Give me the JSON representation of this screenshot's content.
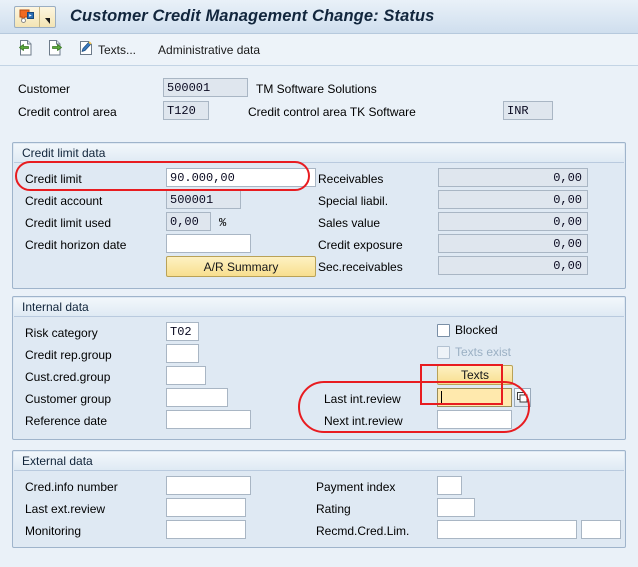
{
  "window": {
    "title": "Customer Credit Management Change: Status",
    "system_menu_icon": "sap-system-menu-icon"
  },
  "toolbar": {
    "back_icon": "back-page-icon",
    "forward_icon": "forward-page-icon",
    "texts_icon": "texts-pencil-icon",
    "texts_label": "Texts...",
    "admin_data_label": "Administrative data"
  },
  "header": {
    "customer_label": "Customer",
    "customer_value": "500001",
    "customer_name": "TM Software Solutions",
    "control_area_label": "Credit control area",
    "control_area_value": "T120",
    "control_area_desc": "Credit control area TK Software",
    "currency_value": "INR"
  },
  "credit_limit_data": {
    "title": "Credit limit data",
    "left_rows": [
      {
        "label": "Credit limit",
        "value": "90.000,00",
        "state": "editable"
      },
      {
        "label": "Credit account",
        "value": "500001",
        "state": "display"
      },
      {
        "label": "Credit limit used",
        "value": "0,00",
        "state": "display",
        "suffix": "%"
      },
      {
        "label": "Credit horizon date",
        "value": "",
        "state": "editable"
      }
    ],
    "ar_summary_button": "A/R Summary",
    "right_rows": [
      {
        "label": "Receivables",
        "value": "0,00"
      },
      {
        "label": "Special liabil.",
        "value": "0,00"
      },
      {
        "label": "Sales value",
        "value": "0,00"
      },
      {
        "label": "Credit exposure",
        "value": "0,00"
      },
      {
        "label": "Sec.receivables",
        "value": "0,00"
      }
    ]
  },
  "internal_data": {
    "title": "Internal data",
    "left_rows": [
      {
        "label": "Risk category",
        "value": "T02"
      },
      {
        "label": "Credit rep.group",
        "value": ""
      },
      {
        "label": "Cust.cred.group",
        "value": ""
      },
      {
        "label": "Customer group",
        "value": ""
      },
      {
        "label": "Reference date",
        "value": ""
      }
    ],
    "blocked_label": "Blocked",
    "blocked_checked": false,
    "texts_exist_label": "Texts exist",
    "texts_exist_checked": false,
    "texts_exist_disabled": true,
    "texts_button": "Texts",
    "last_int_review_label": "Last int.review",
    "last_int_review_value": "",
    "next_int_review_label": "Next int.review",
    "next_int_review_value": "",
    "matchcode_icon": "matchcode-value-help-icon"
  },
  "external_data": {
    "title": "External data",
    "left_rows": [
      {
        "label": "Cred.info number",
        "value": ""
      },
      {
        "label": "Last ext.review",
        "value": ""
      },
      {
        "label": "Monitoring",
        "value": ""
      }
    ],
    "right_rows": [
      {
        "label": "Payment index",
        "value": ""
      },
      {
        "label": "Rating",
        "value": ""
      },
      {
        "label": "Recmd.Cred.Lim.",
        "value": "",
        "value2": ""
      }
    ]
  },
  "annotations": {
    "highlight_color": "#e81c20",
    "focused_field": "Last int.review"
  }
}
